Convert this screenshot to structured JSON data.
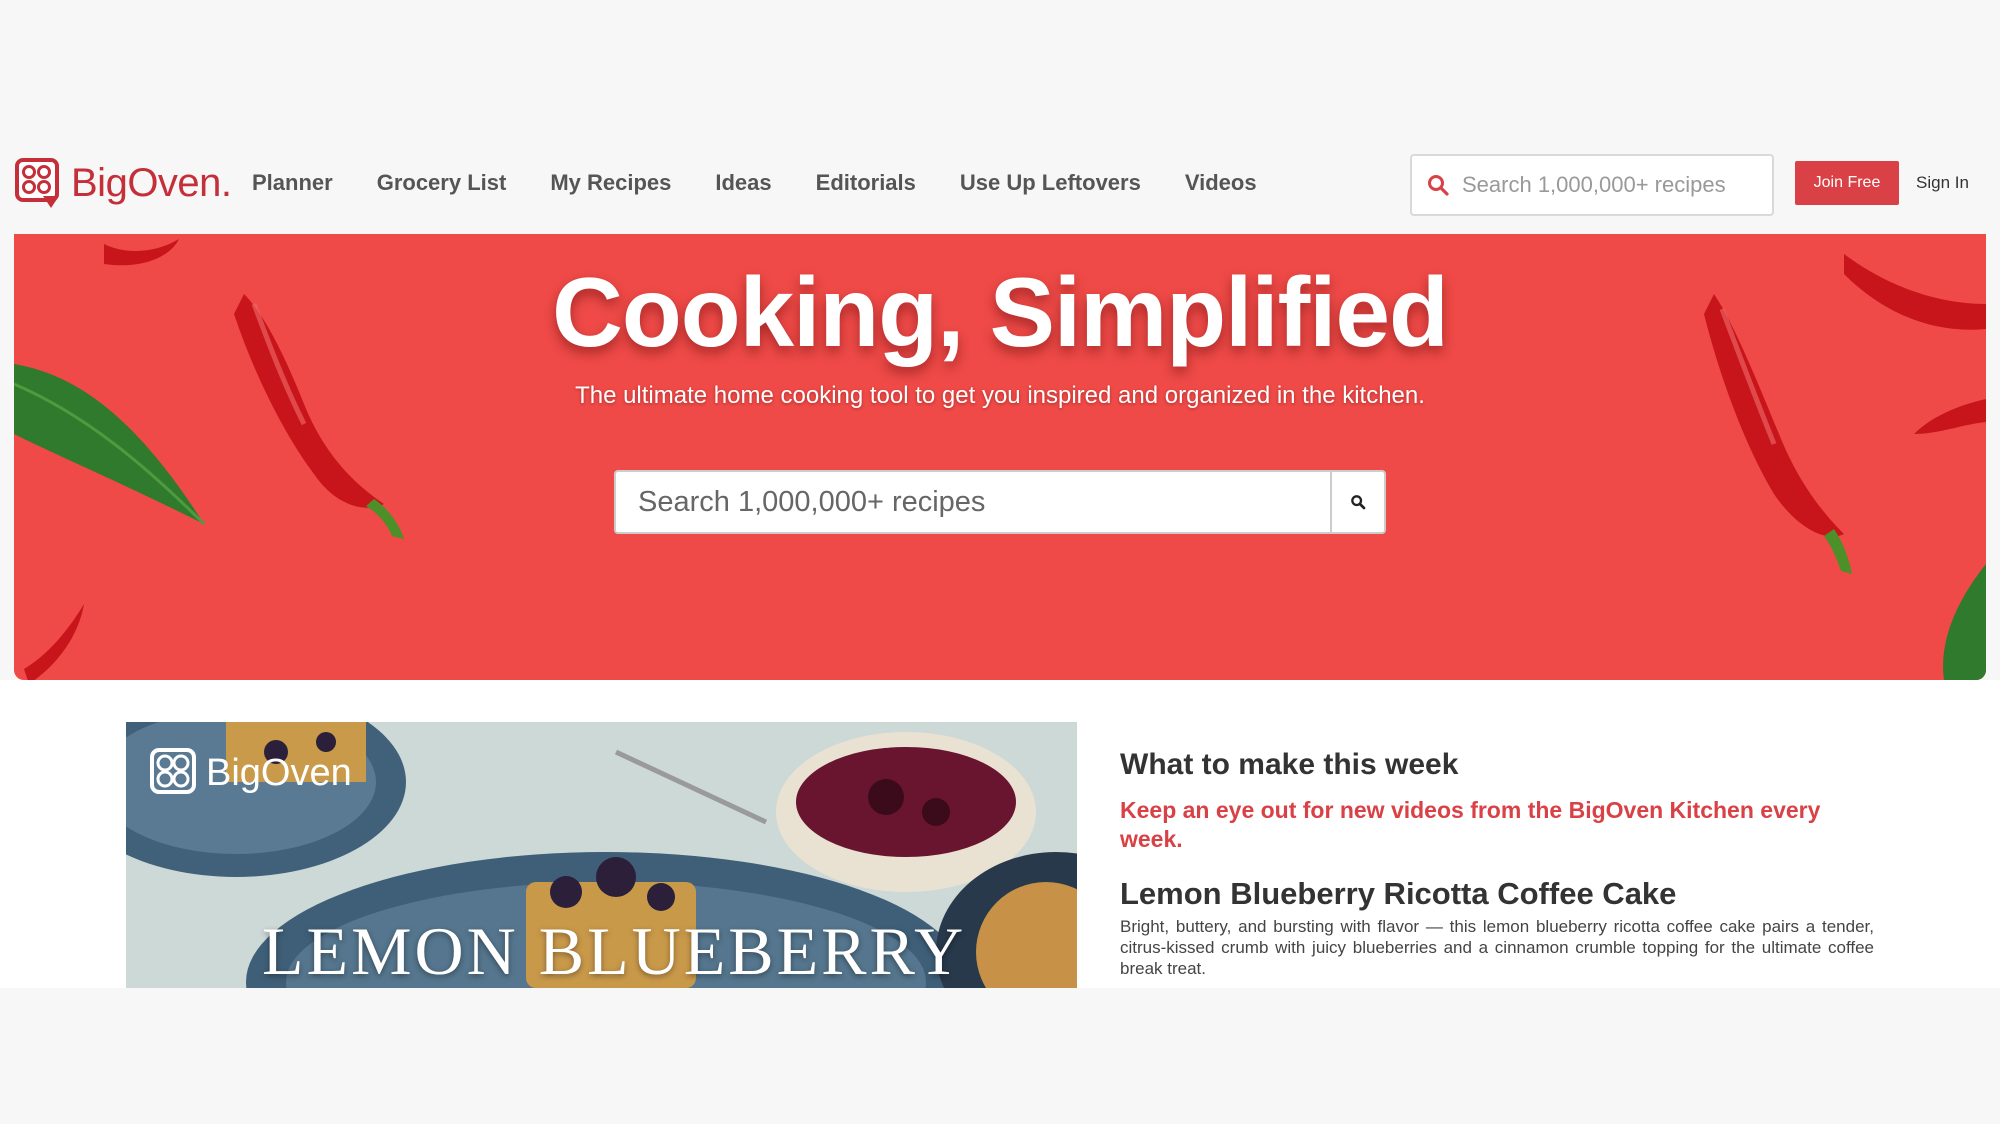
{
  "brand": {
    "name": "BigOven",
    "period": ".",
    "color": "#c42f3a"
  },
  "nav": {
    "items": [
      {
        "label": "Planner"
      },
      {
        "label": "Grocery List"
      },
      {
        "label": "My Recipes"
      },
      {
        "label": "Ideas"
      },
      {
        "label": "Editorials"
      },
      {
        "label": "Use Up Leftovers"
      },
      {
        "label": "Videos"
      }
    ]
  },
  "header": {
    "search_placeholder": "Search 1,000,000+ recipes",
    "join_label": "Join Free",
    "signin_label": "Sign In"
  },
  "hero": {
    "title": "Cooking, Simplified",
    "subtitle": "The ultimate home cooking tool to get you inspired and organized in the kitchen.",
    "search_placeholder": "Search 1,000,000+ recipes",
    "background_color": "#ef4a47"
  },
  "feature": {
    "video_brand": "BigOven",
    "video_caption": "LEMON BLUEBERRY",
    "heading": "What to make this week",
    "subheading": "Keep an eye out for new videos from the BigOven Kitchen every week.",
    "recipe_title": "Lemon Blueberry Ricotta Coffee Cake",
    "recipe_description": "Bright, buttery, and bursting with flavor — this lemon blueberry ricotta coffee cake pairs a tender, citrus-kissed crumb with juicy blueberries and a cinnamon crumble topping for the ultimate coffee break treat."
  },
  "colors": {
    "accent": "#d94146",
    "text": "#333333"
  },
  "icons": {
    "search": "search-icon",
    "logo": "bigoven-logo-icon"
  }
}
